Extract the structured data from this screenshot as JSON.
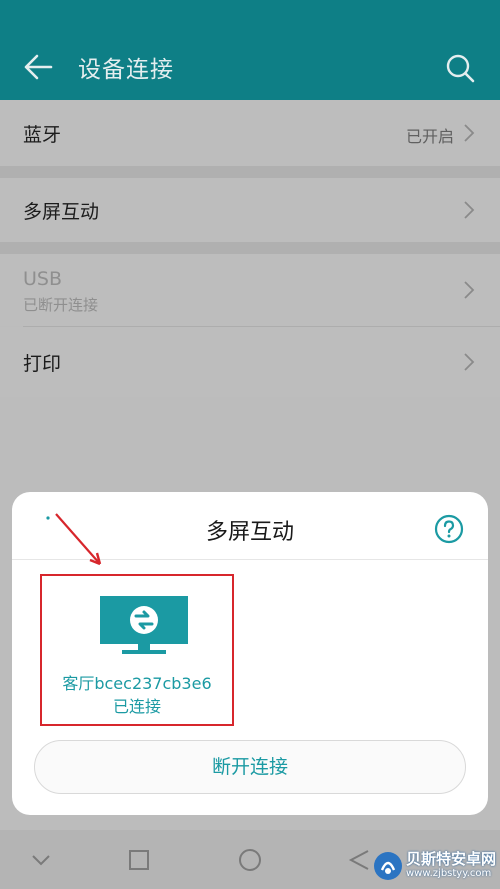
{
  "app_bar": {
    "title": "设备连接",
    "back_icon": "arrow-left-icon",
    "search_icon": "search-icon",
    "background": "#0e7f86"
  },
  "settings": {
    "bluetooth": {
      "label": "蓝牙",
      "value": "已开启"
    },
    "multiscreen": {
      "label": "多屏互动"
    },
    "usb": {
      "label": "USB",
      "sub": "已断开连接"
    },
    "print": {
      "label": "打印"
    }
  },
  "sheet": {
    "title": "多屏互动",
    "help_icon": "question-circle-icon",
    "device": {
      "name": "客厅bcec237cb3e6",
      "status": "已连接",
      "icon": "tv-cast-icon"
    },
    "disconnect_label": "断开连接",
    "accent": "#1b9aa3",
    "highlight": "#d7262c"
  },
  "navbar": {
    "icons": [
      "chevron-down-icon",
      "square-icon",
      "circle-icon",
      "back-triangle-icon"
    ]
  },
  "watermark": {
    "name": "贝斯特安卓网",
    "url": "www.zjbstyy.com"
  }
}
